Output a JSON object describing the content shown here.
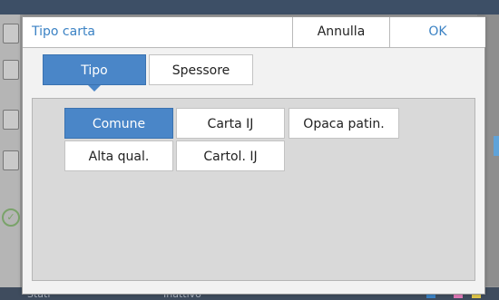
{
  "background": {
    "bottom_bar": {
      "left_text": "Stati",
      "center_text": "Inattivo"
    }
  },
  "dialog": {
    "title": "Tipo carta",
    "cancel_label": "Annulla",
    "ok_label": "OK"
  },
  "tabs": [
    {
      "label": "Tipo",
      "selected": true
    },
    {
      "label": "Spessore",
      "selected": false
    }
  ],
  "options": [
    {
      "label": "Comune",
      "selected": true
    },
    {
      "label": "Carta IJ",
      "selected": false
    },
    {
      "label": "Opaca patin.",
      "selected": false
    },
    {
      "label": "Alta qual.",
      "selected": false
    },
    {
      "label": "Cartol. IJ",
      "selected": false
    }
  ],
  "colors": {
    "accent": "#4a86c8",
    "title_text": "#3b82c4",
    "panel": "#d9d9d9"
  }
}
